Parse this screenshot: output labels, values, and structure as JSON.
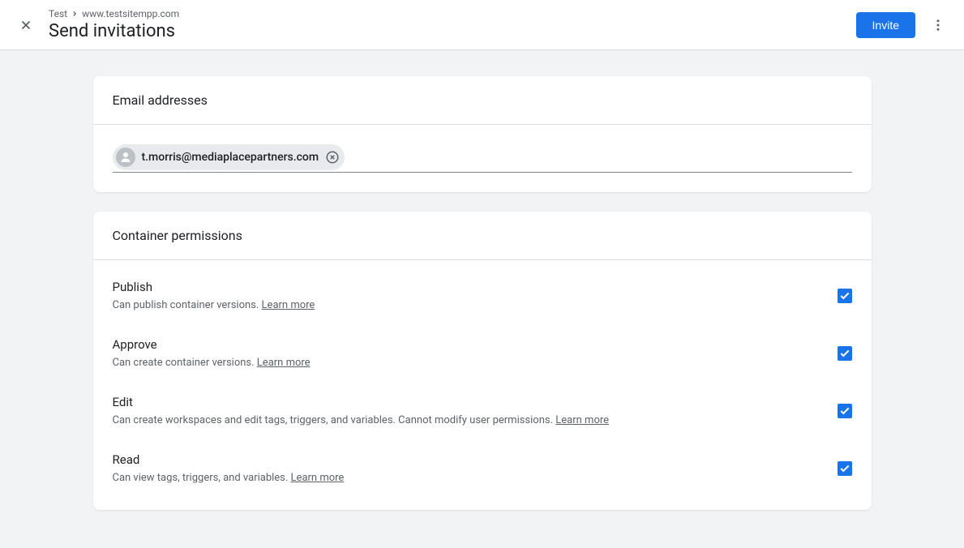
{
  "header": {
    "breadcrumb_account": "Test",
    "breadcrumb_container": "www.testsitempp.com",
    "title": "Send invitations",
    "invite_label": "Invite"
  },
  "email_card": {
    "title": "Email addresses",
    "chip_email": "t.morris@mediaplacepartners.com"
  },
  "permissions_card": {
    "title": "Container permissions",
    "learn_more_label": "Learn more",
    "items": [
      {
        "title": "Publish",
        "desc": "Can publish container versions. ",
        "checked": true
      },
      {
        "title": "Approve",
        "desc": "Can create container versions. ",
        "checked": true
      },
      {
        "title": "Edit",
        "desc": "Can create workspaces and edit tags, triggers, and variables. Cannot modify user permissions. ",
        "checked": true
      },
      {
        "title": "Read",
        "desc": "Can view tags, triggers, and variables. ",
        "checked": true
      }
    ]
  }
}
